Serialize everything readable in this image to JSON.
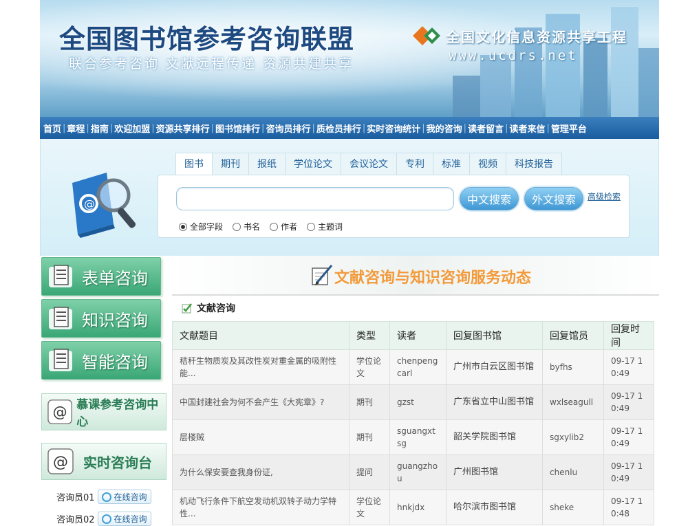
{
  "banner": {
    "title": "全国图书馆参考咨询联盟",
    "subtitle": "联合参考咨询  文献远程传递  资源共建共享",
    "brand": "全国文化信息资源共享工程",
    "site": "www.ucdrs.net"
  },
  "nav": {
    "items": [
      "首页",
      "章程",
      "指南",
      "欢迎加盟",
      "资源共享排行",
      "图书馆排行",
      "咨询员排行",
      "质检员排行",
      "实时咨询统计",
      "我的咨询",
      "读者留言",
      "读者来信",
      "管理平台"
    ],
    "separator": "|"
  },
  "search": {
    "tabs": [
      "图书",
      "期刊",
      "报纸",
      "学位论文",
      "会议论文",
      "专利",
      "标准",
      "视频",
      "科技报告"
    ],
    "active_tab": 0,
    "input_value": "",
    "btn_chinese": "中文搜索",
    "btn_foreign": "外文搜索",
    "advanced_link": "高级检索",
    "fields": [
      "全部字段",
      "书名",
      "作者",
      "主题词"
    ],
    "selected_field": 0
  },
  "sidebar": {
    "form_consult": "表单咨询",
    "knowledge_consult": "知识咨询",
    "smart_consult": "智能咨询",
    "mooc_center": "慕课参考咨询中心",
    "realtime_desk": "实时咨询台",
    "consultants": [
      {
        "name": "咨询员01",
        "status": "在线咨询"
      },
      {
        "name": "咨询员02",
        "status": "在线咨询"
      }
    ]
  },
  "main": {
    "news_title": "文献咨询与知识咨询服务动态",
    "section_title": "文献咨询",
    "table": {
      "headers": [
        "文献题目",
        "类型",
        "读者",
        "回复图书馆",
        "回复馆员",
        "回复时间"
      ],
      "rows": [
        [
          "秸秆生物质炭及其改性炭对重金属的吸附性能...",
          "学位论文",
          "chenpengcarl",
          "广州市白云区图书馆",
          "byfhs",
          "09-17 10:49"
        ],
        [
          "中国封建社会为何不会产生《大宪章》?",
          "期刊",
          "gzst",
          "广东省立中山图书馆",
          "wxlseagull",
          "09-17 10:49"
        ],
        [
          "层楼贼",
          "期刊",
          "sguangxtsg",
          "韶关学院图书馆",
          "sgxylib2",
          "09-17 10:49"
        ],
        [
          "为什么保安要查我身份证,",
          "提问",
          "guangzhou",
          "广州图书馆",
          "chenlu",
          "09-17 10:49"
        ],
        [
          "机动飞行条件下航空发动机双转子动力学特性...",
          "学位论文",
          "hnkjdx",
          "哈尔滨市图书馆",
          "sheke",
          "09-17 10:48"
        ]
      ]
    }
  }
}
